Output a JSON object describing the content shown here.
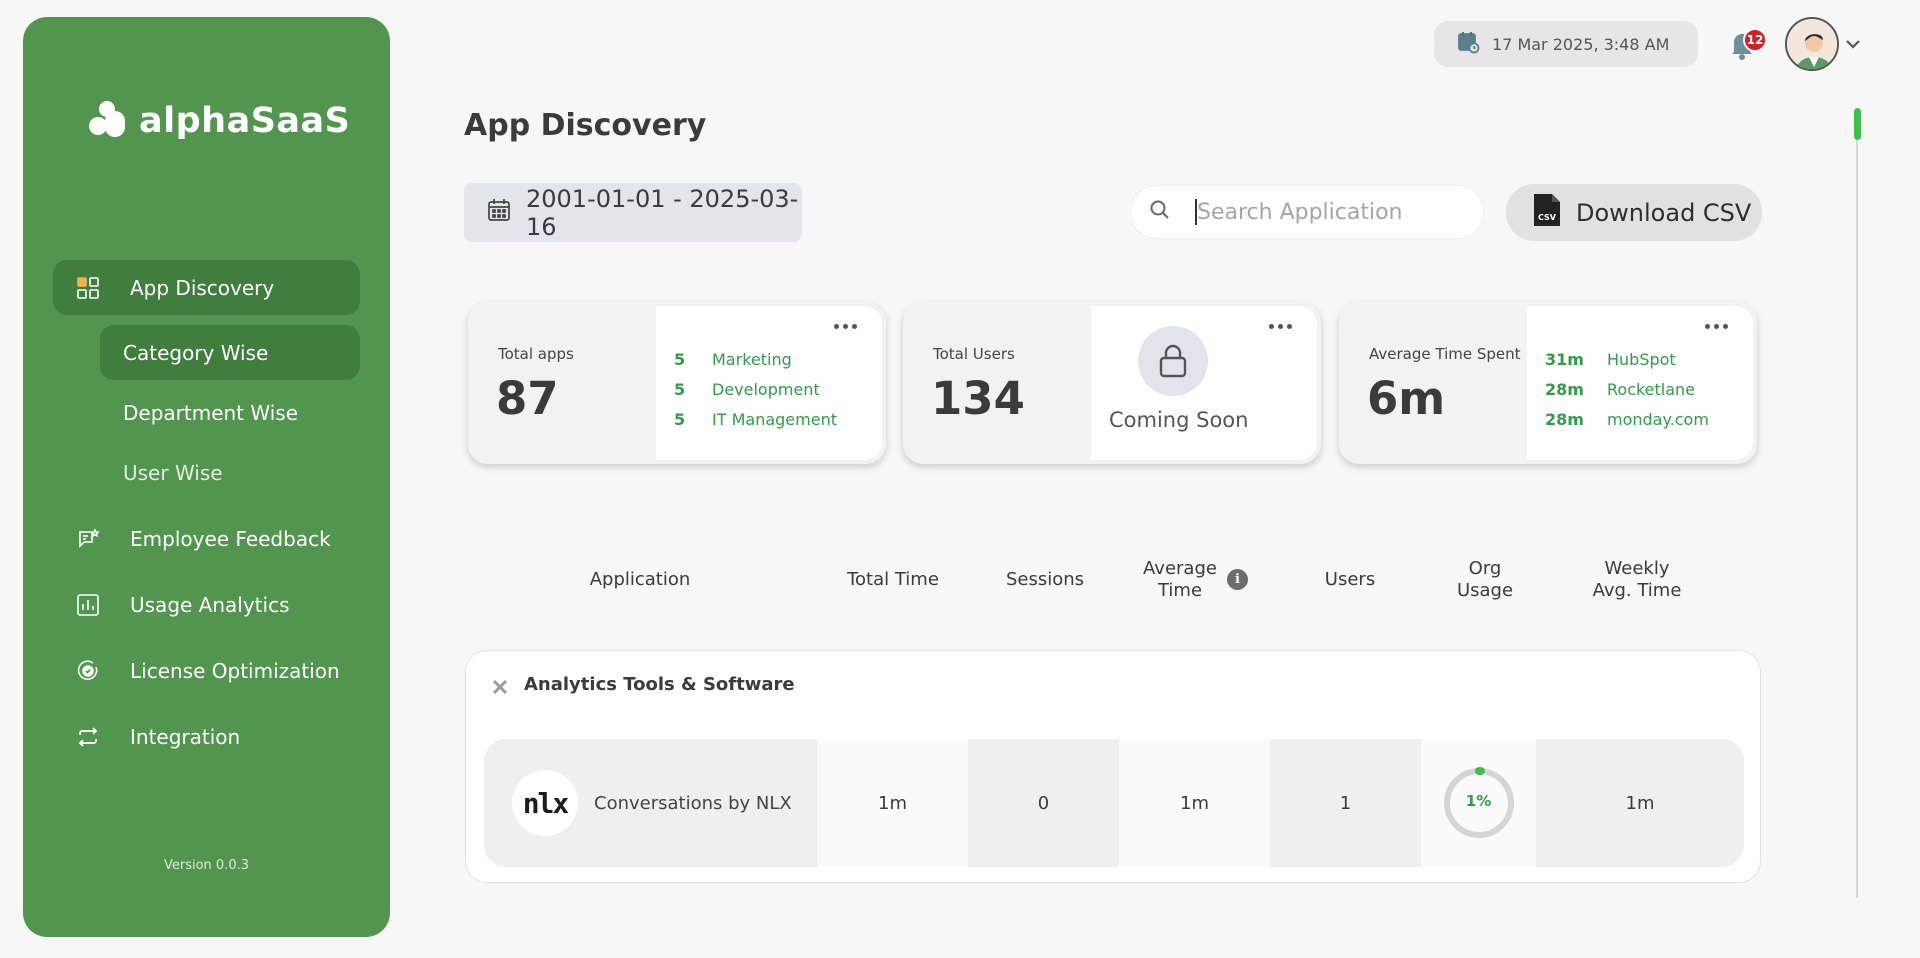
{
  "brand": {
    "name": "alphaSaaS",
    "version": "Version 0.0.3"
  },
  "sidebar": {
    "items": [
      {
        "label": "App Discovery",
        "icon": "grid-icon",
        "active": true
      },
      {
        "label": "Employee Feedback",
        "icon": "feedback-icon"
      },
      {
        "label": "Usage Analytics",
        "icon": "bar-chart-icon"
      },
      {
        "label": "License Optimization",
        "icon": "badge-check-icon"
      },
      {
        "label": "Integration",
        "icon": "sync-icon"
      }
    ],
    "subitems": [
      {
        "label": "Category Wise",
        "active": true
      },
      {
        "label": "Department Wise"
      },
      {
        "label": "User Wise"
      }
    ]
  },
  "header": {
    "datetime": "17 Mar 2025, 3:48 AM",
    "notifications": "12"
  },
  "page": {
    "title": "App Discovery",
    "date_range": "2001-01-01 - 2025-03-16",
    "search_placeholder": "Search Application",
    "download_label": "Download CSV",
    "csv_icon_text": "CSV"
  },
  "stats": {
    "apps": {
      "label": "Total apps",
      "value": "87",
      "top": [
        {
          "n": "5",
          "name": "Marketing"
        },
        {
          "n": "5",
          "name": "Development"
        },
        {
          "n": "5",
          "name": "IT Management"
        }
      ]
    },
    "users": {
      "label": "Total Users",
      "value": "134",
      "note": "Coming Soon"
    },
    "time": {
      "label": "Average Time Spent",
      "value": "6m",
      "top": [
        {
          "n": "31m",
          "name": "HubSpot"
        },
        {
          "n": "28m",
          "name": "Rocketlane"
        },
        {
          "n": "28m",
          "name": "monday.com"
        }
      ]
    }
  },
  "table": {
    "headers": {
      "application": "Application",
      "total_time": "Total Time",
      "sessions": "Sessions",
      "avg_time_1": "Average",
      "avg_time_2": "Time",
      "users": "Users",
      "org_1": "Org",
      "org_2": "Usage",
      "weekly_1": "Weekly",
      "weekly_2": "Avg. Time"
    },
    "category": "Analytics Tools & Software",
    "rows": [
      {
        "logo_text": "nlx",
        "name": "Conversations by NLX",
        "total_time": "1m",
        "sessions": "0",
        "avg_time": "1m",
        "users": "1",
        "org_usage": "1%",
        "org_usage_fraction": 0.01,
        "weekly_avg": "1m"
      }
    ]
  },
  "colors": {
    "sidebar": "#51954f",
    "sidebar_active": "#3f7e3d",
    "accent_green": "#2e9e47",
    "badge_red": "#d32027"
  }
}
